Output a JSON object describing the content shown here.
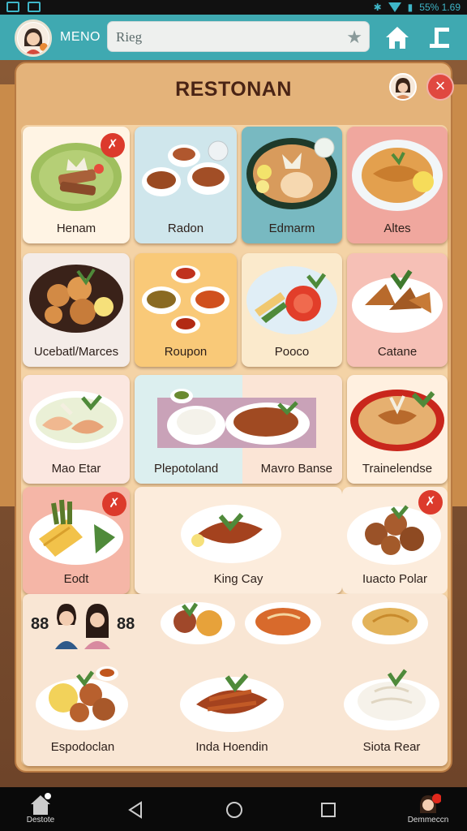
{
  "status": {
    "clock": "55% 1.69"
  },
  "top_bar": {
    "menu_label": "MENO",
    "search_value": "Rieg"
  },
  "header": {
    "title": "RESTONAN"
  },
  "tiles": [
    {
      "label": "Henam",
      "bg": "#fff4e4"
    },
    {
      "label": "Radon",
      "bg": "#cfe6ec"
    },
    {
      "label": "Edmarm",
      "bg": "#78b9c1"
    },
    {
      "label": "Altes",
      "bg": "#f0a79e"
    },
    {
      "label": "Ucebatl/Marces",
      "bg": "#f4ece8"
    },
    {
      "label": "Roupon",
      "bg": "#f9c978"
    },
    {
      "label": "Pooco",
      "bg": "#fbeacc"
    },
    {
      "label": "Catane",
      "bg": "#f6c0b6"
    },
    {
      "label": "Mao Etar",
      "bg": "#fbe7e0"
    },
    {
      "label": "Plepotoland",
      "bg": "#dcefef"
    },
    {
      "label": "Mavro Banse",
      "bg": "#fbe5d6"
    },
    {
      "label": "Trainelendse",
      "bg": "#fff0e0"
    },
    {
      "label": "Eodt",
      "bg": "#f5b6a7"
    },
    {
      "label": "King Cay",
      "bg": "#fcecdc"
    },
    {
      "label": "Iuacto Polar",
      "bg": "#fcecdc"
    }
  ],
  "bottom": {
    "labels": [
      "Espodoclan",
      "Inda Hoendin",
      "Siota Rear"
    ],
    "group_marks": [
      "88",
      "88"
    ]
  },
  "nav": {
    "left_label": "Destote",
    "right_label": "Demmeccn"
  }
}
